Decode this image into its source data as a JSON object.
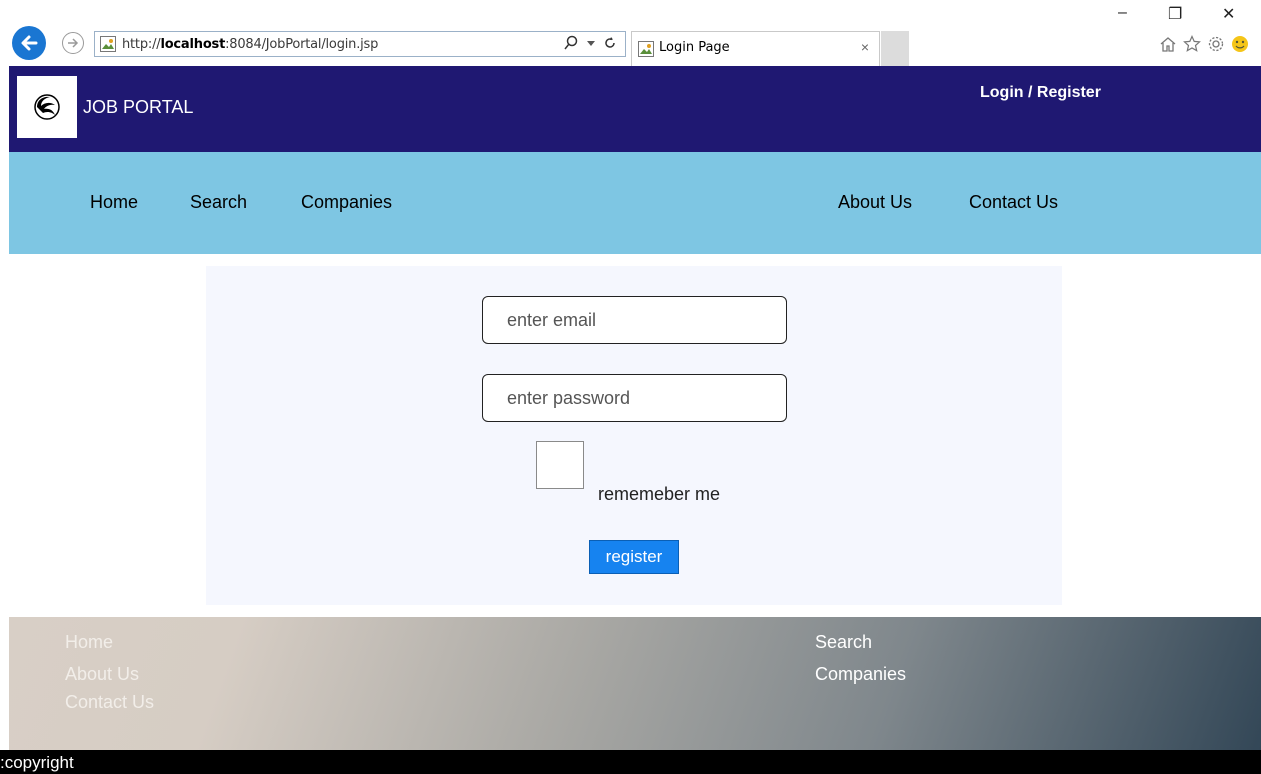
{
  "browser": {
    "url_prefix": "http://",
    "url_host": "localhost",
    "url_rest": ":8084/JobPortal/login.jsp",
    "tab_title": "Login Page",
    "tab_close": "×",
    "minimize": "–",
    "restore": "❐",
    "close": "✕"
  },
  "header": {
    "brand": "JOB PORTAL",
    "login": "Login",
    "separator": " / ",
    "register": "Register"
  },
  "nav": {
    "items": [
      "Home",
      "Search",
      "Companies",
      "About Us",
      "Contact Us"
    ]
  },
  "form": {
    "email_placeholder": "enter email",
    "password_placeholder": "enter password",
    "remember_label": "rememeber me",
    "register_button": "register"
  },
  "footer": {
    "left_links": [
      "Home",
      "About Us",
      "Contact Us"
    ],
    "right_links": [
      "Search",
      "Companies"
    ],
    "copyright": ":copyright"
  },
  "colors": {
    "header_bg": "#1f1872",
    "nav_bg": "#7ec6e3",
    "card_bg": "#f5f7fe",
    "button_bg": "#1683f0"
  }
}
